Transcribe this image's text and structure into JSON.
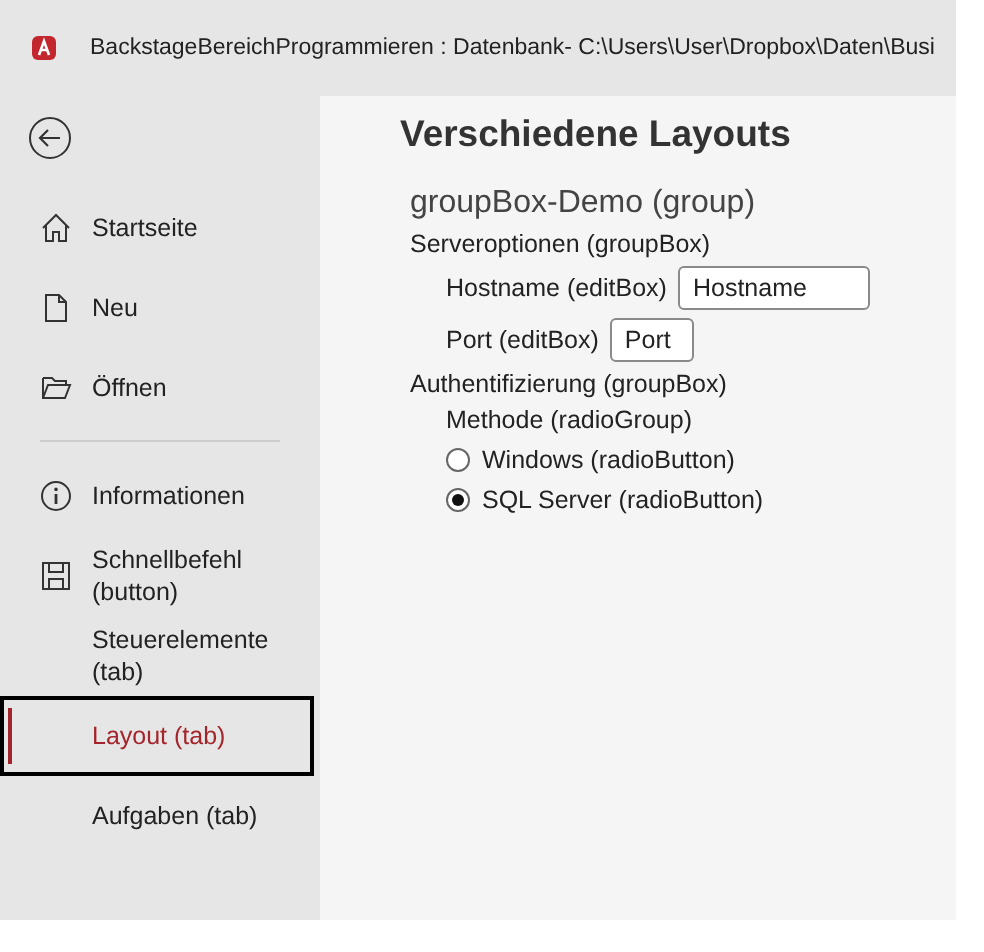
{
  "window": {
    "title": "BackstageBereichProgrammieren : Datenbank- C:\\Users\\User\\Dropbox\\Daten\\Busi"
  },
  "sidebar": {
    "top_items": [
      {
        "label": "Startseite",
        "selected": false
      },
      {
        "label": "Neu",
        "selected": false
      },
      {
        "label": "Öffnen",
        "selected": false
      }
    ],
    "items": [
      {
        "label": "Informationen",
        "selected": false
      },
      {
        "label": "Schnellbefehl (button)",
        "selected": false
      },
      {
        "label": "Steuerelemente (tab)",
        "selected": false
      },
      {
        "label": "Layout (tab)",
        "selected": true
      },
      {
        "label": "Aufgaben (tab)",
        "selected": false
      }
    ]
  },
  "content": {
    "title": "Verschiedene Layouts",
    "group": "groupBox-Demo (group)",
    "server_box": {
      "label": "Serveroptionen (groupBox)",
      "fields": [
        {
          "label": "Hostname (editBox)",
          "value": "Hostname"
        },
        {
          "label": "Port (editBox)",
          "value": "Port"
        }
      ]
    },
    "auth_box": {
      "label": "Authentifizierung (groupBox)",
      "radio_group": "Methode (radioGroup)",
      "options": [
        {
          "label": "Windows (radioButton)",
          "selected": false
        },
        {
          "label": "SQL Server (radioButton)",
          "selected": true
        }
      ]
    }
  }
}
